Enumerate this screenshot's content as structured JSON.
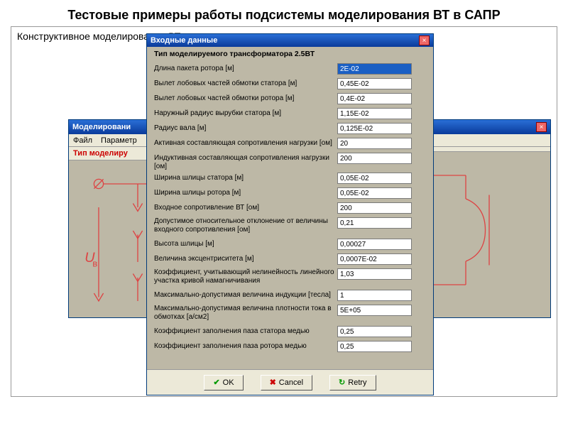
{
  "page_title": "Тестовые примеры работы подсистемы моделирования ВТ в САПР",
  "subtitle": "Конструктивное моделирование ВТ",
  "bgwin": {
    "title_left": "Моделировани",
    "menu": {
      "file": "Файл",
      "params": "Параметр"
    },
    "redband": "Тип моделиру"
  },
  "dialog": {
    "title": "Входные данные",
    "subheader": "Тип моделируемого трансформатора 2.5ВТ"
  },
  "fields": [
    {
      "label": "Длина пакета ротора [м]",
      "value": "2E-02",
      "sel": true
    },
    {
      "label": "Вылет лобовых частей обмотки статора [м]",
      "value": "0,45E-02"
    },
    {
      "label": "Вылет лобовых частей обмотки ротора [м]",
      "value": "0,4E-02"
    },
    {
      "label": "Наружный радиус вырубки  статора [м]",
      "value": "1,15E-02"
    },
    {
      "label": "Радиус вала [м]",
      "value": "0,125E-02"
    },
    {
      "label": "Активная составляющая сопротивления нагрузки [ом]",
      "value": "20"
    },
    {
      "label": "Индуктивная составляющая сопротивления нагрузки [ом]",
      "value": "200"
    },
    {
      "label": "Ширина шлицы статора [м]",
      "value": "0,05E-02"
    },
    {
      "label": "Ширина шлицы ротора [м]",
      "value": "0,05E-02"
    },
    {
      "label": "Входное сопротивление ВТ [ом]",
      "value": "200"
    },
    {
      "label": "Допустимое относительное отклонение\nот величины входного сопротивления [ом]",
      "value": "0,21",
      "tall": true
    },
    {
      "label": "Высота шлицы [м]",
      "value": "0,00027"
    },
    {
      "label": "Величина эксцентриситета [м]",
      "value": "0,0007E-02"
    },
    {
      "label": "Коэффициент, учитывающий нелинейность\nлинейного участка кривой намагничивания",
      "value": "1,03",
      "tall": true
    },
    {
      "label": "Максимально-допустимая величина индукции [тесла]",
      "value": "1"
    },
    {
      "label": "Максимально-допустимая величина плотности тока\nв обмотках [a/cм2]",
      "value": "5E+05",
      "tall": true
    },
    {
      "label": "Коэффициент заполнения паза статора медью",
      "value": "0,25"
    },
    {
      "label": "Коэффициент заполнения паза ротора медью",
      "value": "0,25"
    }
  ],
  "buttons": {
    "ok": "OK",
    "cancel": "Cancel",
    "retry": "Retry"
  }
}
